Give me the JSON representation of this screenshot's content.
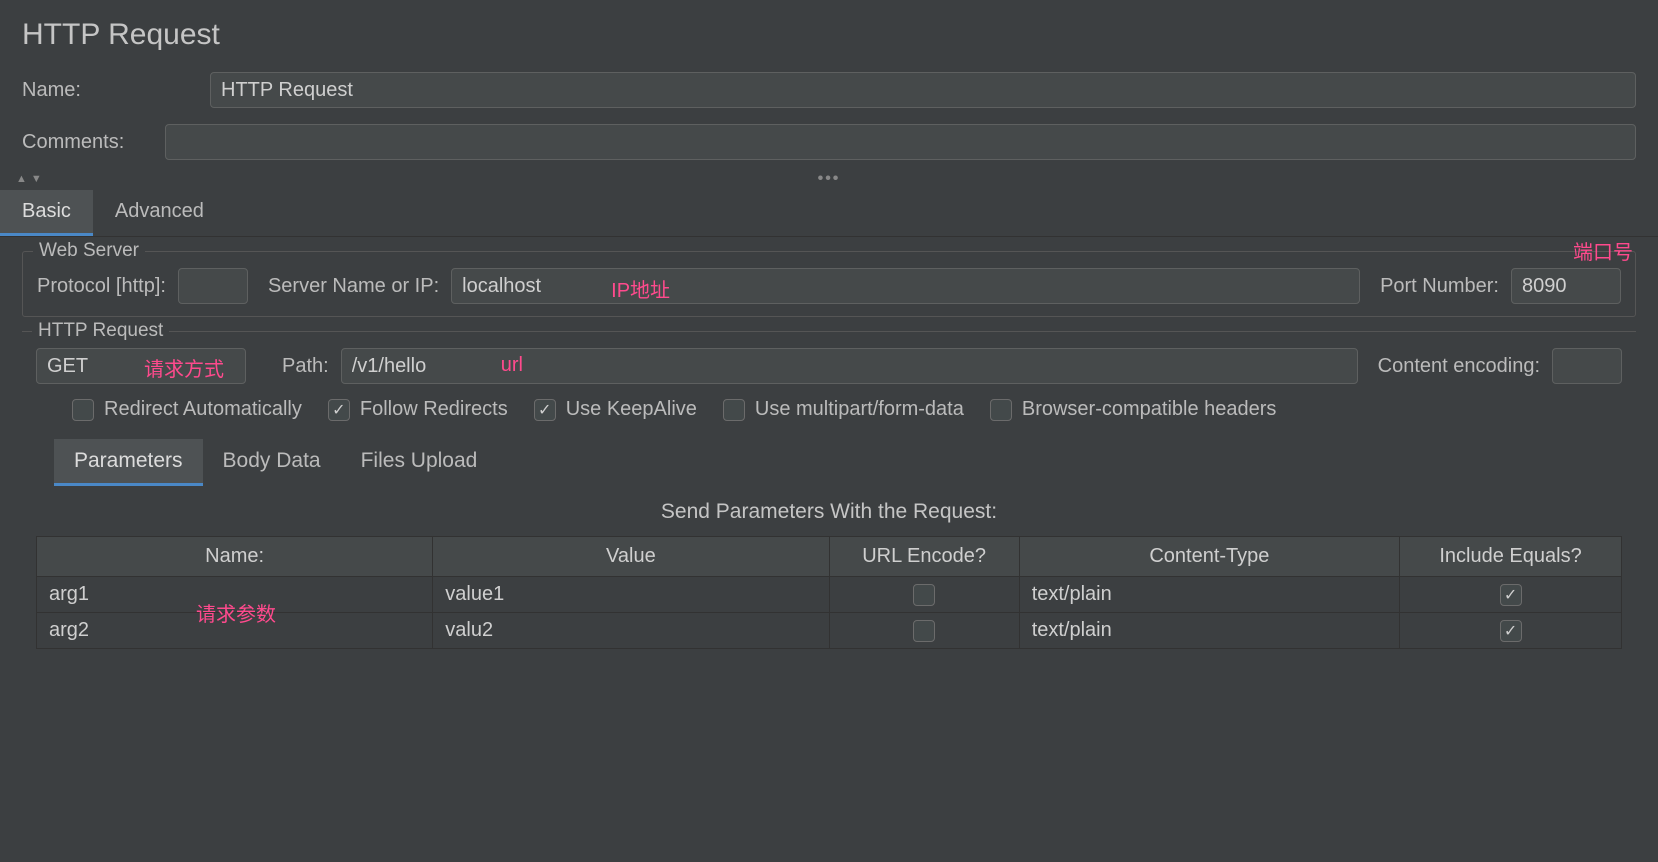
{
  "title": "HTTP Request",
  "name_label": "Name:",
  "name_value": "HTTP Request",
  "comments_label": "Comments:",
  "comments_value": "",
  "tabs": {
    "basic": "Basic",
    "advanced": "Advanced"
  },
  "web_server": {
    "legend": "Web Server",
    "protocol_label": "Protocol [http]:",
    "protocol_value": "",
    "server_label": "Server Name or IP:",
    "server_value": "localhost",
    "port_label": "Port Number:",
    "port_value": "8090"
  },
  "http_request": {
    "legend": "HTTP Request",
    "method": "GET",
    "path_label": "Path:",
    "path_value": "/v1/hello",
    "encoding_label": "Content encoding:",
    "encoding_value": ""
  },
  "checkboxes": {
    "redirect_auto": "Redirect Automatically",
    "follow_redirects": "Follow Redirects",
    "keepalive": "Use KeepAlive",
    "multipart": "Use multipart/form-data",
    "browser_compat": "Browser-compatible headers"
  },
  "sub_tabs": {
    "parameters": "Parameters",
    "body_data": "Body Data",
    "files_upload": "Files Upload"
  },
  "params_title": "Send Parameters With the Request:",
  "columns": {
    "name": "Name:",
    "value": "Value",
    "url_encode": "URL Encode?",
    "content_type": "Content-Type",
    "include_equals": "Include Equals?"
  },
  "rows": [
    {
      "name": "arg1",
      "value": "value1",
      "url_encode": false,
      "content_type": "text/plain",
      "include_equals": true
    },
    {
      "name": "arg2",
      "value": "valu2",
      "url_encode": false,
      "content_type": "text/plain",
      "include_equals": true
    }
  ],
  "annotations": {
    "ip": "IP地址",
    "port": "端口号",
    "method": "请求方式",
    "url": "url",
    "params": "请求参数"
  }
}
